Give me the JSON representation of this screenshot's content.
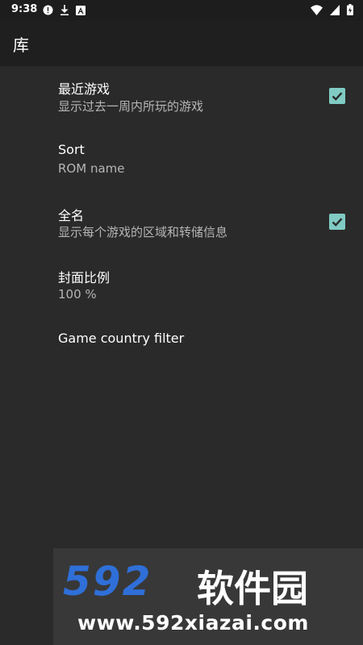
{
  "status_bar": {
    "time": "9:38",
    "left_icons": [
      "alert-icon",
      "download-icon",
      "font-icon"
    ],
    "right_icons": [
      "wifi-icon",
      "signal-icon",
      "battery-icon"
    ]
  },
  "app_bar": {
    "title": "库"
  },
  "preferences": [
    {
      "title": "最近游戏",
      "summary": "显示过去一周内所玩的游戏",
      "checked": true
    },
    {
      "title": "Sort",
      "summary": "ROM name"
    },
    {
      "title": "全名",
      "summary": "显示每个游戏的区域和转储信息",
      "checked": true
    },
    {
      "title": "封面比例",
      "summary": "100 %"
    },
    {
      "title": "Game country filter"
    }
  ],
  "watermark": {
    "brand": "592",
    "brand_cn": "软件园",
    "url": "www.592xiazai.com",
    "brand_color": "#2f6fd8"
  },
  "colors": {
    "background": "#2a2a2a",
    "app_bar": "#1f1f1f",
    "status_bar": "#1d1d1d",
    "accent": "#80cbc4"
  }
}
